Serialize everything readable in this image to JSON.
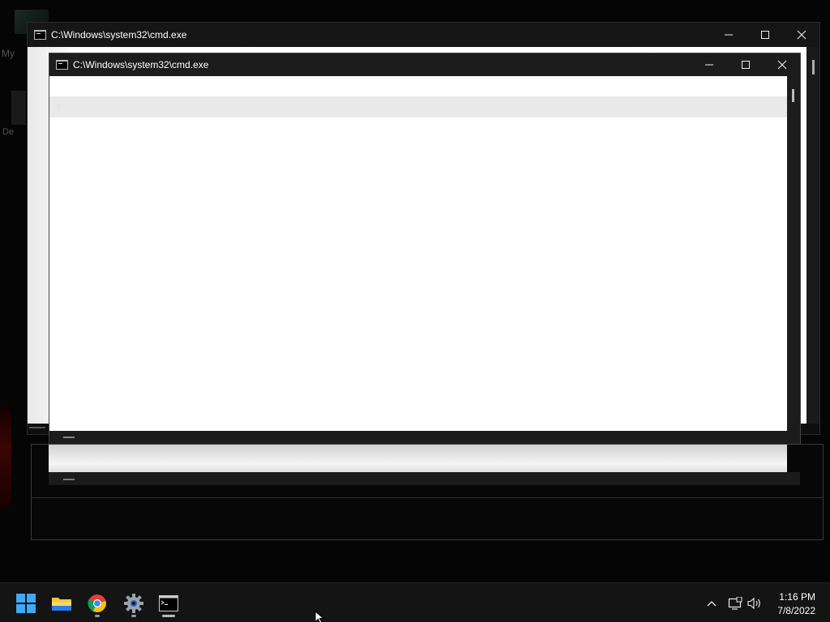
{
  "desktop": {
    "icon_label_1": "My",
    "icon_label_2": "De"
  },
  "windows": [
    {
      "id": "back",
      "title": "C:\\Windows\\system32\\cmd.exe"
    },
    {
      "id": "front",
      "title": "C:\\Windows\\system32\\cmd.exe"
    }
  ],
  "taskbar": {
    "apps": [
      {
        "name": "Start",
        "icon": "windows-start-icon"
      },
      {
        "name": "File Explorer",
        "icon": "folder-icon"
      },
      {
        "name": "Google Chrome",
        "icon": "chrome-icon",
        "running": true
      },
      {
        "name": "Settings",
        "icon": "gear-icon",
        "running": true
      },
      {
        "name": "Command Prompt",
        "icon": "terminal-icon",
        "running": true,
        "active": true
      }
    ],
    "tray_icons": [
      "chevron-up-icon",
      "network-icon",
      "volume-icon"
    ],
    "clock": {
      "time": "1:16 PM",
      "date": "7/8/2022"
    }
  },
  "colors": {
    "desktop_bg": "#050505",
    "titlebar_bg": "#1c1c1c",
    "client_bg": "#ffffff",
    "taskbar_bg": "#141414",
    "start_blue": "#3fa9f5"
  }
}
